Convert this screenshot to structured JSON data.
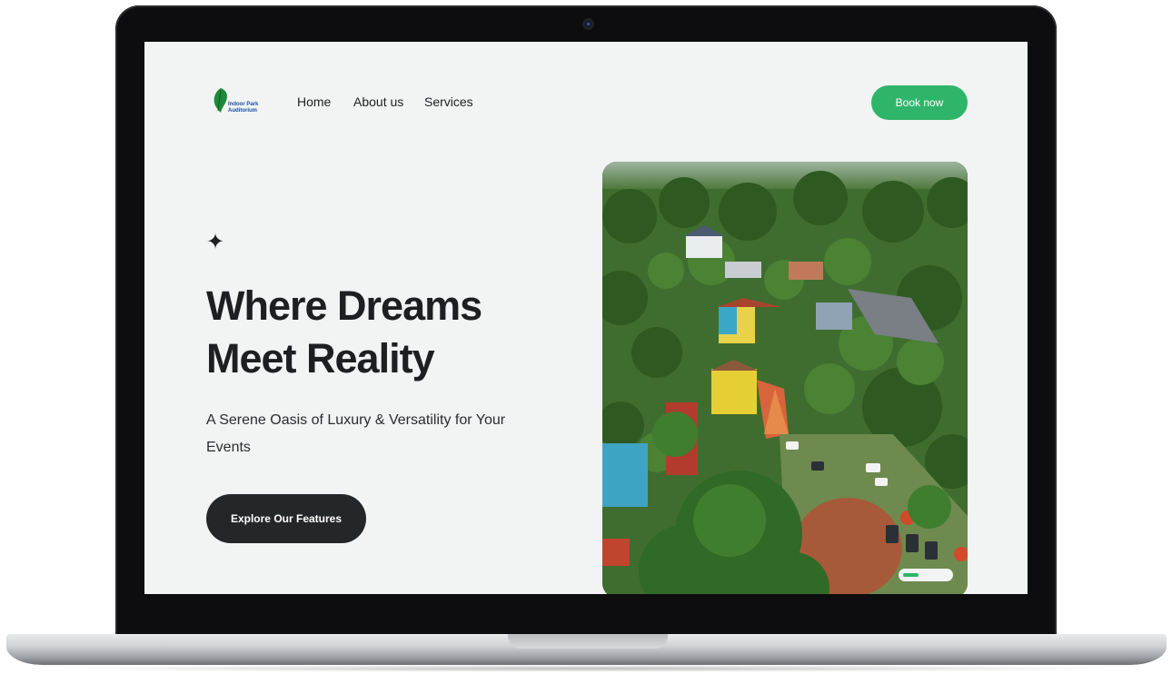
{
  "logo": {
    "text": "Indoor Park Auditorium",
    "icon": "leaf-icon"
  },
  "nav": {
    "home": "Home",
    "about": "About us",
    "services": "Services"
  },
  "cta": {
    "book": "Book now"
  },
  "hero": {
    "sparkle": "✦",
    "title_line1": "Where Dreams",
    "title_line2": "Meet Reality",
    "subtitle": "A Serene Oasis of Luxury & Versatility for Your Events",
    "button": "Explore Our Features"
  },
  "slider": {
    "progress": 0.33
  },
  "colors": {
    "accent": "#2fb56a",
    "dark": "#24272a",
    "background": "#f1f4f3"
  }
}
